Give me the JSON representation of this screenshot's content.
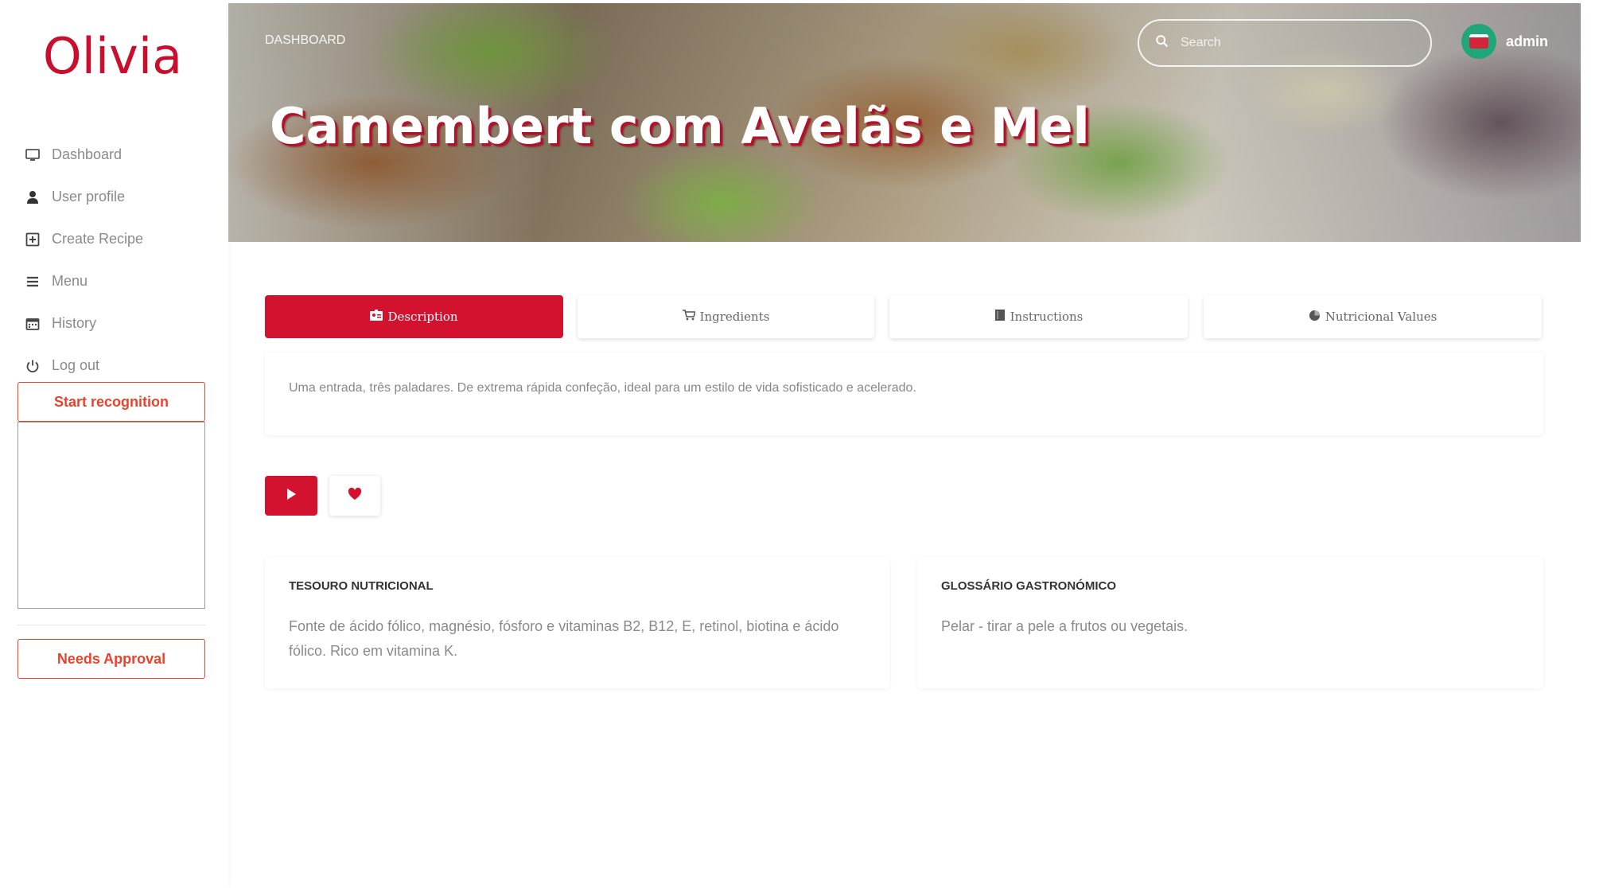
{
  "brand": "Olivia",
  "sidebar": {
    "items": [
      {
        "label": "Dashboard",
        "icon": "monitor-icon"
      },
      {
        "label": "User profile",
        "icon": "user-icon"
      },
      {
        "label": "Create Recipe",
        "icon": "plus-square-icon"
      },
      {
        "label": "Menu",
        "icon": "menu-icon"
      },
      {
        "label": "History",
        "icon": "calendar-icon"
      },
      {
        "label": "Log out",
        "icon": "power-icon"
      }
    ],
    "start_recognition": "Start recognition",
    "needs_approval": "Needs Approval"
  },
  "header": {
    "breadcrumb": "DASHBOARD",
    "title": "Camembert com Avelãs e Mel",
    "search_placeholder": "Search",
    "user_name": "admin"
  },
  "tabs": [
    {
      "label": "Description",
      "icon": "id-card-icon",
      "active": true
    },
    {
      "label": "Ingredients",
      "icon": "cart-icon",
      "active": false
    },
    {
      "label": "Instructions",
      "icon": "book-icon",
      "active": false
    },
    {
      "label": "Nutricional Values",
      "icon": "pie-chart-icon",
      "active": false
    }
  ],
  "description": "Uma entrada, três paladares. De extrema rápida confeção, ideal para um estilo de vida sofisticado e acelerado.",
  "cards": {
    "nutrition": {
      "title": "TESOURO NUTRICIONAL",
      "body": "Fonte de ácido fólico, magnésio, fósforo e vitaminas B2, B12, E, retinol, biotina e ácido fólico. Rico em vitamina K."
    },
    "glossary": {
      "title": "GLOSSÁRIO GASTRONÓMICO",
      "body": "Pelar - tirar a pele a frutos ou vegetais."
    }
  },
  "colors": {
    "accent": "#d3122f",
    "brand": "#c8102e",
    "outline": "#e8432d"
  }
}
